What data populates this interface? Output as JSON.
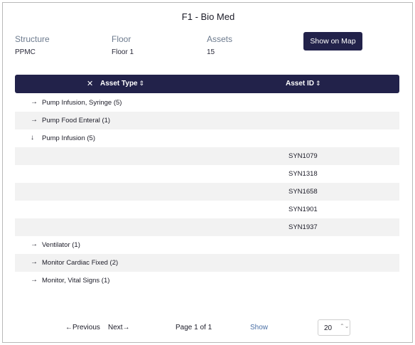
{
  "title": "F1 - Bio Med",
  "meta": {
    "structure_label": "Structure",
    "structure_value": "PPMC",
    "floor_label": "Floor",
    "floor_value": "Floor 1",
    "assets_label": "Assets",
    "assets_value": "15"
  },
  "show_on_map_label": "Show on Map",
  "table": {
    "clear_icon": "✕",
    "col_type": "Asset Type",
    "col_id": "Asset ID",
    "sort_icon": "⇕",
    "rows": [
      {
        "arrow": "→",
        "label": "Pump Infusion, Syringe (5)",
        "id": ""
      },
      {
        "arrow": "→",
        "label": "Pump Food Enteral (1)",
        "id": ""
      },
      {
        "arrow": "↓",
        "label": "Pump Infusion (5)",
        "id": ""
      },
      {
        "arrow": "",
        "label": "",
        "id": "SYN1079"
      },
      {
        "arrow": "",
        "label": "",
        "id": "SYN1318"
      },
      {
        "arrow": "",
        "label": "",
        "id": "SYN1658"
      },
      {
        "arrow": "",
        "label": "",
        "id": "SYN1901"
      },
      {
        "arrow": "",
        "label": "",
        "id": "SYN1937"
      },
      {
        "arrow": "→",
        "label": "Ventilator (1)",
        "id": ""
      },
      {
        "arrow": "→",
        "label": "Monitor Cardiac Fixed (2)",
        "id": ""
      },
      {
        "arrow": "→",
        "label": "Monitor, Vital Signs (1)",
        "id": ""
      }
    ]
  },
  "pagination": {
    "previous": "←Previous",
    "next": "Next→",
    "page_info": "Page 1 of 1",
    "show_label": "Show",
    "page_size": "20",
    "stepper_icon": "⌃⌄"
  },
  "colors": {
    "accent": "#22224a",
    "label": "#6d7b8e",
    "row_alt": "#f2f2f2"
  }
}
